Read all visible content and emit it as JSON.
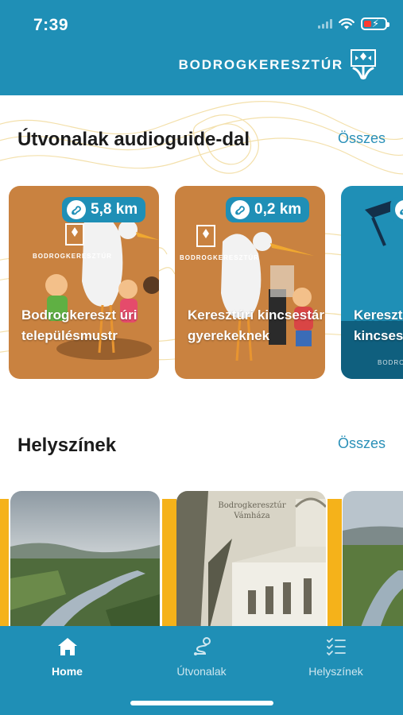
{
  "status_bar": {
    "time": "7:39"
  },
  "header": {
    "brand": "BODROGKERESZTÚR",
    "logo_icon": "town-logo-icon"
  },
  "routes_section": {
    "title": "Útvonalak audioguide-dal",
    "see_all": "Összes",
    "cards": [
      {
        "distance": "5,8 km",
        "title": "Bodrogkereszt úri településmustr",
        "logo_text": "BODROGKERESZTÚR",
        "icon": "walking-route-icon"
      },
      {
        "distance": "0,2 km",
        "title": "Keresztúri kincsestár gyerekeknek",
        "logo_text": "BODROGKERESZTÚR",
        "icon": "walking-route-icon"
      },
      {
        "distance": "",
        "title": "Kereszt kincses",
        "logo_text": "BODROG",
        "icon": "walking-route-icon"
      }
    ]
  },
  "places_section": {
    "title": "Helyszínek",
    "see_all": "Összes",
    "cards": [
      {
        "caption": ""
      },
      {
        "caption": "Bodrogkeresztúr Vámháza"
      },
      {
        "caption": ""
      }
    ]
  },
  "tab_bar": {
    "tabs": [
      {
        "label": "Home",
        "icon": "home-icon",
        "active": true
      },
      {
        "label": "Útvonalak",
        "icon": "route-icon",
        "active": false
      },
      {
        "label": "Helyszínek",
        "icon": "checklist-icon",
        "active": false
      }
    ]
  },
  "colors": {
    "brand_blue": "#1f8fb6",
    "accent_yellow": "#f5b21a",
    "card_orange": "#c98240",
    "link_blue": "#2a90b8"
  }
}
